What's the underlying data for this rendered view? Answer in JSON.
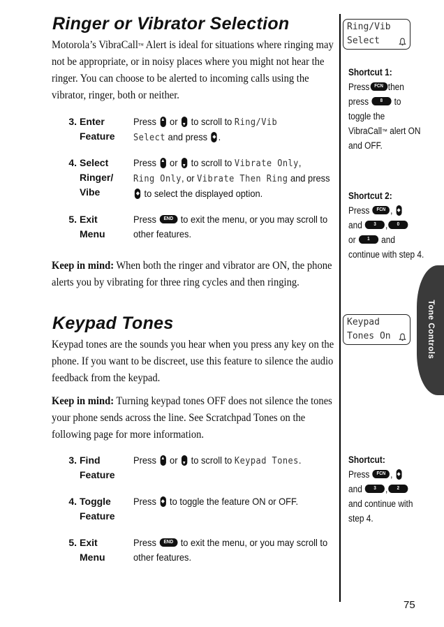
{
  "section1": {
    "title": "Ringer or Vibrator Selection",
    "intro_a": "Motorola’s VibraCall",
    "intro_tm": "™",
    "intro_b": " Alert is ideal for situations where ringing may not be appropriate, or in noisy places where you might not hear the ringer. You can choose to be alerted to incoming calls using the vibrator, ringer, both or neither.",
    "steps": [
      {
        "num": "3.",
        "label_1": "Enter",
        "label_2": "Feature",
        "t1": "Press",
        "t2": "or",
        "t3": "to scroll to",
        "lcd1": "Ring/Vib",
        "lcd2": "Select",
        "t4": "and press",
        "t5": "."
      },
      {
        "num": "4.",
        "label_1": "Select",
        "label_2": "Ringer/",
        "label_3": "Vibe",
        "t1": "Press",
        "t2": "or",
        "t3": "to scroll to",
        "lcd1": "Vibrate Only",
        "t4": ",",
        "lcd2": "Ring Only",
        "t5": ", or",
        "lcd3": "Vibrate Then Ring",
        "t6": "and press",
        "t7": "to select the displayed option."
      },
      {
        "num": "5.",
        "label_1": "Exit",
        "label_2": "Menu",
        "t1": "Press",
        "key": "END",
        "t2": "to exit the menu, or you may scroll to other features."
      }
    ],
    "keep_in_mind_label": "Keep in mind:",
    "keep_in_mind_text": " When both the ringer and vibrator are ON, the phone alerts you by vibrating for three ring cycles and then ringing."
  },
  "section2": {
    "title": "Keypad Tones",
    "intro": "Keypad tones are the sounds you hear when you press any key on the phone. If you want to be discreet, use this feature to silence the audio feedback from the keypad.",
    "keep_in_mind_label": "Keep in mind:",
    "keep_in_mind_text": " Turning keypad tones OFF does not silence the tones your phone sends across the line. See Scratchpad Tones on the following page for more information.",
    "steps": [
      {
        "num": "3.",
        "label_1": "Find",
        "label_2": "Feature",
        "t1": "Press",
        "t2": "or",
        "t3": "to scroll to",
        "lcd1": "Keypad Tones",
        "t4": "."
      },
      {
        "num": "4.",
        "label_1": "Toggle",
        "label_2": "Feature",
        "t1": "Press",
        "t2": "to toggle the feature ON or OFF."
      },
      {
        "num": "5.",
        "label_1": "Exit",
        "label_2": "Menu",
        "t1": "Press",
        "key": "END",
        "t2": "to exit the menu, or you may scroll to other features."
      }
    ]
  },
  "sidebar": {
    "lcd1": {
      "line1": "Ring/Vib",
      "line2": "Select",
      "icon": "bell-icon"
    },
    "lcd2": {
      "line1": "Keypad",
      "line2": "Tones On",
      "icon": "bell-icon"
    },
    "shortcut1": {
      "title": "Shortcut 1:",
      "t1": "Press",
      "k1": "FCN",
      "t2": "then press",
      "k2": "8",
      "t3": "to toggle the VibraCall",
      "tm": "™",
      "t4": " alert ON and OFF."
    },
    "shortcut2": {
      "title": "Shortcut 2:",
      "t1": "Press",
      "k1": "FCN",
      "t2": ",",
      "t3": "and",
      "k2": "3",
      "t4": ",",
      "k3": "0",
      "t5": "or",
      "k4": "1",
      "t6": "and continue with step 4."
    },
    "shortcut3": {
      "title": "Shortcut:",
      "t1": "Press",
      "k1": "FCN",
      "t2": ",",
      "t3": "and",
      "k2": "3",
      "t4": ",",
      "k3": "2",
      "t5": "and continue with step 4."
    }
  },
  "tab": {
    "label": "Tone Controls",
    "color": "#3a3a3a"
  },
  "page_number": "75"
}
